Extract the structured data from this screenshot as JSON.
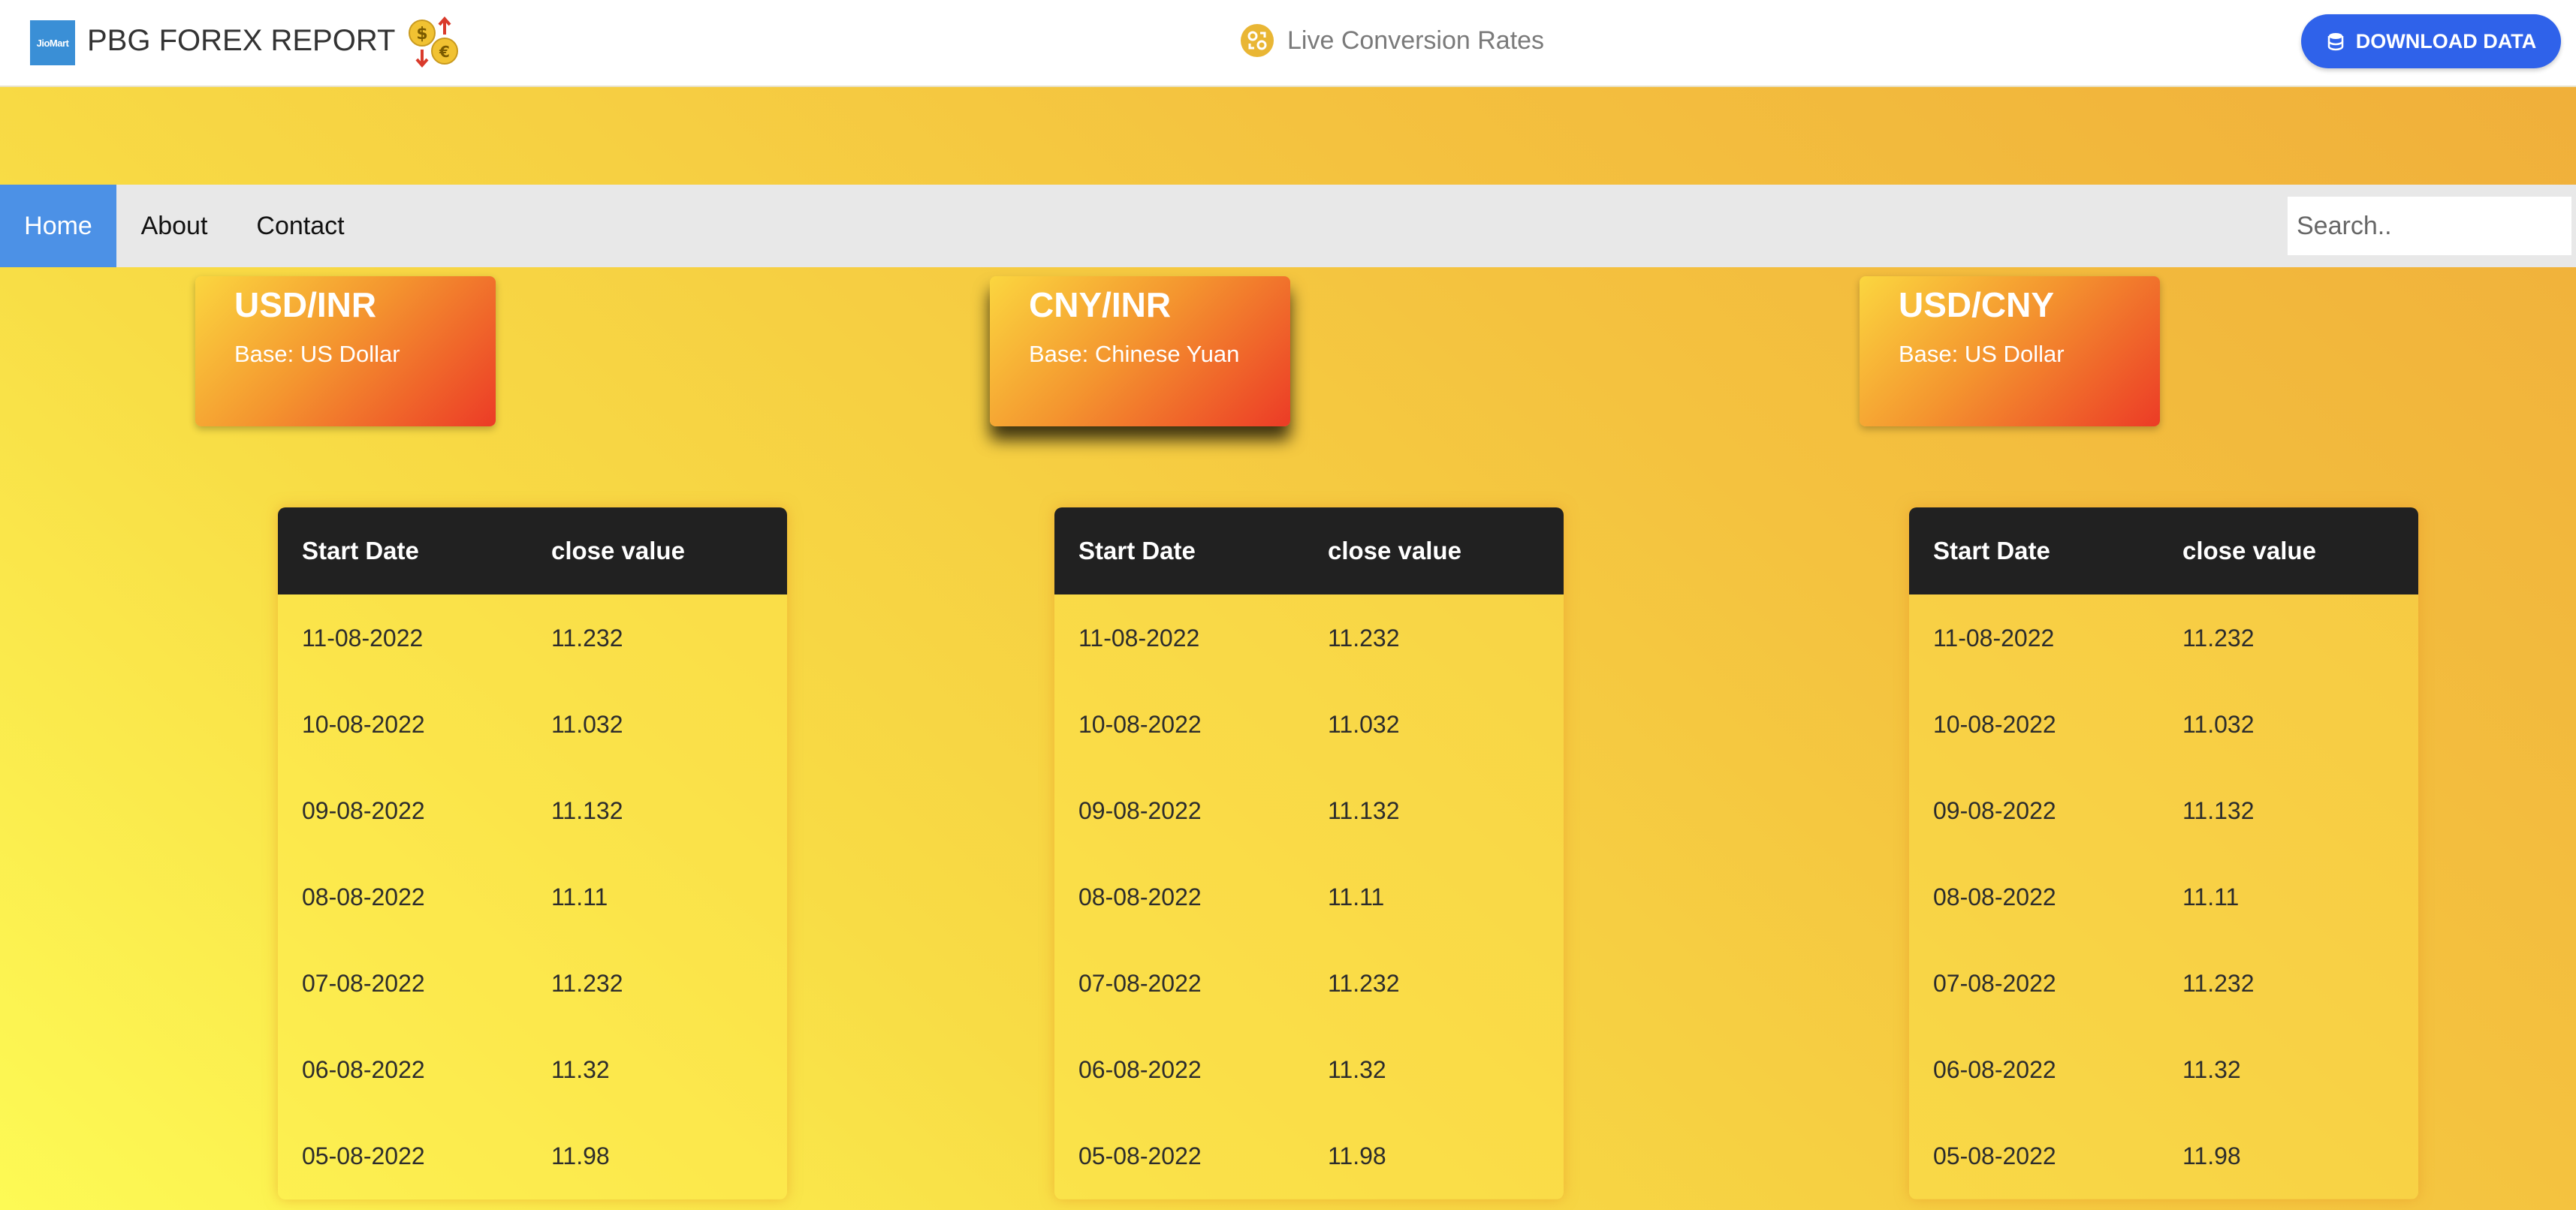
{
  "header": {
    "logo_text": "JioMart",
    "title": "PBG FOREX REPORT",
    "live_label": "Live Conversion Rates",
    "download_label": "DOWNLOAD DATA"
  },
  "icons": {
    "fx": "currency-exchange-icon",
    "live": "live-rates-icon",
    "download": "download-data-icon"
  },
  "colors": {
    "accent_blue": "#2f62ea",
    "nav_active": "#4c91e6",
    "table_header": "#212121",
    "card_gradient_start": "#fbd63f",
    "card_gradient_end": "#ec3b26"
  },
  "nav": {
    "home": "Home",
    "about": "About",
    "contact": "Contact",
    "active": "Home"
  },
  "search": {
    "placeholder": "Search.."
  },
  "cards": [
    {
      "pair": "USD/INR",
      "base": "Base: US Dollar"
    },
    {
      "pair": "CNY/INR",
      "base": "Base: Chinese Yuan"
    },
    {
      "pair": "USD/CNY",
      "base": "Base: US Dollar"
    }
  ],
  "tables": [
    {
      "headers": [
        "Start Date",
        "close value"
      ],
      "rows": [
        [
          "11-08-2022",
          "11.232"
        ],
        [
          "10-08-2022",
          "11.032"
        ],
        [
          "09-08-2022",
          "11.132"
        ],
        [
          "08-08-2022",
          "11.11"
        ],
        [
          "07-08-2022",
          "11.232"
        ],
        [
          "06-08-2022",
          "11.32"
        ],
        [
          "05-08-2022",
          "11.98"
        ]
      ]
    },
    {
      "headers": [
        "Start Date",
        "close value"
      ],
      "rows": [
        [
          "11-08-2022",
          "11.232"
        ],
        [
          "10-08-2022",
          "11.032"
        ],
        [
          "09-08-2022",
          "11.132"
        ],
        [
          "08-08-2022",
          "11.11"
        ],
        [
          "07-08-2022",
          "11.232"
        ],
        [
          "06-08-2022",
          "11.32"
        ],
        [
          "05-08-2022",
          "11.98"
        ]
      ]
    },
    {
      "headers": [
        "Start Date",
        "close value"
      ],
      "rows": [
        [
          "11-08-2022",
          "11.232"
        ],
        [
          "10-08-2022",
          "11.032"
        ],
        [
          "09-08-2022",
          "11.132"
        ],
        [
          "08-08-2022",
          "11.11"
        ],
        [
          "07-08-2022",
          "11.232"
        ],
        [
          "06-08-2022",
          "11.32"
        ],
        [
          "05-08-2022",
          "11.98"
        ]
      ]
    }
  ]
}
